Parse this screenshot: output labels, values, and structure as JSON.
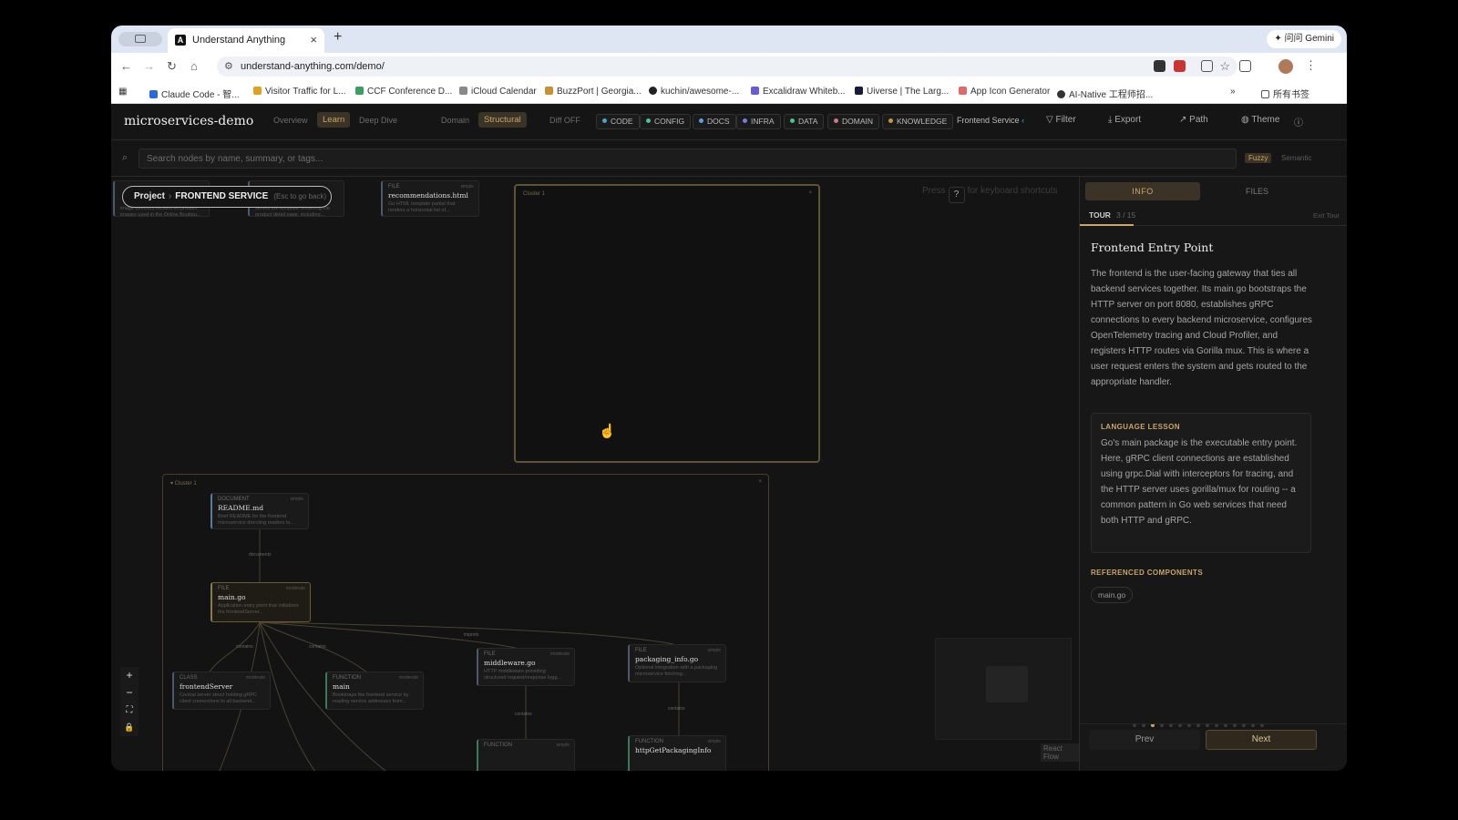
{
  "browser": {
    "tab_title": "Understand Anything",
    "tab_favicon": "A",
    "url": "understand-anything.com/demo/",
    "gemini_label": "✦ 问问 Gemini",
    "bookmarks": [
      "Claude Code - 智...",
      "Visitor Traffic for L...",
      "CCF Conference D...",
      "iCloud Calendar",
      "BuzzPort | Georgia...",
      "kuchin/awesome-...",
      "Excalidraw Whiteb...",
      "Uiverse | The Larg...",
      "App Icon Generator",
      "AI-Native 工程师招...",
      "所有书签"
    ]
  },
  "app": {
    "title": "microservices-demo",
    "modes": [
      "Overview",
      "Learn",
      "Deep Dive"
    ],
    "views": [
      "Domain",
      "Structural"
    ],
    "diff": "Diff OFF",
    "categories": [
      {
        "label": "CODE",
        "color": "#4aa3c8"
      },
      {
        "label": "CONFIG",
        "color": "#46c3a0"
      },
      {
        "label": "DOCS",
        "color": "#5aa0e0"
      },
      {
        "label": "INFRA",
        "color": "#7a7ae0"
      },
      {
        "label": "DATA",
        "color": "#46c38a"
      },
      {
        "label": "DOMAIN",
        "color": "#c87a8a"
      },
      {
        "label": "KNOWLEDGE",
        "color": "#c8963c"
      }
    ],
    "service_filter": "Frontend Service",
    "filter_label": "Filter",
    "export_label": "Export",
    "path_label": "Path",
    "theme_label": "Theme",
    "search_placeholder": "Search nodes by name, summary, or tags...",
    "fuzzy_label": "Fuzzy",
    "semantic_label": "Semantic"
  },
  "canvas": {
    "breadcrumb_project": "Project",
    "breadcrumb_current": "FRONTEND SERVICE",
    "breadcrumb_hint": "(Esc to go back)",
    "hint_prefix": "Press",
    "hint_key": "?",
    "hint_suffix": "for keyboard shortcuts",
    "top_cards": [
      {
        "kind": "",
        "name": "",
        "summary": "image directory located on product images used in the Online Boutiqu..."
      },
      {
        "kind": "",
        "name": "",
        "summary": "serves the template rendering the product detail page, including..."
      },
      {
        "kind": "FILE",
        "pill": "simple",
        "name": "recommendations.html",
        "summary": "Go HTML template partial that renders a horizontal list of..."
      }
    ],
    "cluster_top_label": "Cluster 1",
    "cluster_bottom_label": "▾ Cluster 1",
    "cluster_close": "×",
    "nodes": {
      "readme": {
        "kind": "DOCUMENT",
        "pill": "simple",
        "name": "README.md",
        "summary": "Brief README for the frontend microservice directing readers to..."
      },
      "main_go": {
        "kind": "FILE",
        "pill": "moderate",
        "name": "main.go",
        "summary": "Application entry point that initializes the frontendServer..."
      },
      "frontendserver": {
        "kind": "CLASS",
        "pill": "moderate",
        "name": "frontendServer",
        "summary": "Central server struct holding gRPC client connections to all backend..."
      },
      "main_fn": {
        "kind": "FUNCTION",
        "pill": "moderate",
        "name": "main",
        "summary": "Bootstraps the frontend service by reading service addresses from..."
      },
      "middleware": {
        "kind": "FILE",
        "pill": "moderate",
        "name": "middleware.go",
        "summary": "HTTP middleware providing structured request/response logg..."
      },
      "packaging": {
        "kind": "FILE",
        "pill": "simple",
        "name": "packaging_info.go",
        "summary": "Optional integration with a packaging microservice fetching..."
      },
      "fn1": {
        "kind": "FUNCTION",
        "pill": "simple",
        "name": "",
        "summary": ""
      },
      "fn2": {
        "kind": "FUNCTION",
        "pill": "simple",
        "name": "httpGetPackagingInfo",
        "summary": ""
      }
    },
    "edges": {
      "documents": "documents",
      "contains": "contains",
      "imports": "imports"
    },
    "zoom": [
      "+",
      "−",
      "⛶",
      "🔒"
    ],
    "react_flow": "React Flow"
  },
  "sidebar": {
    "tab_info": "INFO",
    "tab_files": "FILES",
    "tour_label": "TOUR",
    "tour_count": "3 / 15",
    "tour_progress": 0.2,
    "exit_tour": "Exit Tour",
    "step_title": "Frontend Entry Point",
    "step_body": "The frontend is the user-facing gateway that ties all backend services together. Its main.go bootstraps the HTTP server on port 8080, establishes gRPC connections to every backend microservice, configures OpenTelemetry tracing and Cloud Profiler, and registers HTTP routes via Gorilla mux. This is where a user request enters the system and gets routed to the appropriate handler.",
    "lesson_heading": "LANGUAGE LESSON",
    "lesson_body": "Go's main package is the executable entry point. Here, gRPC client connections are established using grpc.Dial with interceptors for tracing, and the HTTP server uses gorilla/mux for routing -- a common pattern in Go web services that need both HTTP and gRPC.",
    "refs_heading": "REFERENCED COMPONENTS",
    "ref_chip": "main.go",
    "prev_label": "Prev",
    "next_label": "Next"
  }
}
